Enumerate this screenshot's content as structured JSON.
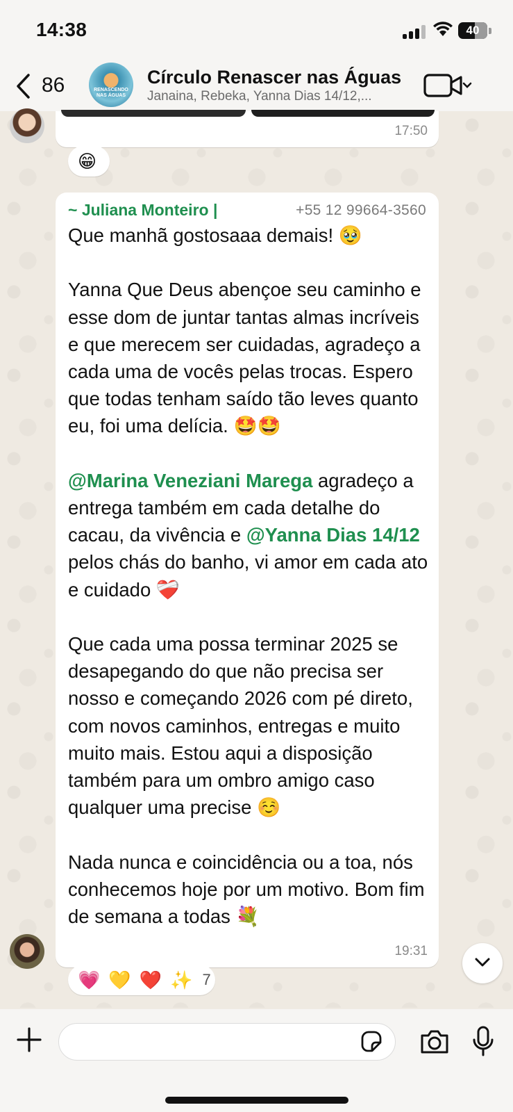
{
  "status_bar": {
    "time": "14:38",
    "battery": "40"
  },
  "header": {
    "back_count": "86",
    "title": "Círculo Renascer nas Águas",
    "subtitle": "Janaina, Rebeka, Yanna Dias 14/12,...",
    "avatar_text": "RENASCENDO NAS ÁGUAS"
  },
  "previous_message": {
    "time": "17:50",
    "reaction": "😁"
  },
  "message": {
    "sender_name": "~ Juliana Monteiro |",
    "sender_phone": "+55 12 99664-3560",
    "p1": "Que manhã gostosaaa demais! 🥹",
    "p2": "Yanna Que Deus abençoe seu caminho e esse dom de juntar tantas almas incríveis e que merecem ser cuidadas, agradeço a cada uma de vocês pelas trocas. Espero que todas tenham saído tão leves quanto eu, foi uma delícia. 🤩🤩",
    "mention1": "@Marina Veneziani Marega",
    "p3a": " agradeço a entrega também em cada detalhe do cacau, da vivência e ",
    "mention2": "@Yanna Dias 14/12",
    "p3b": " pelos chás do banho, vi amor em cada ato e cuidado ❤️‍🩹",
    "p4": "Que cada uma possa terminar 2025 se desapegando do que não precisa ser nosso e começando 2026 com pé direto, com novos caminhos, entregas e muito muito mais. Estou aqui a disposição também para um ombro amigo caso qualquer uma precise ☺️",
    "p5": "Nada nunca e coincidência ou a toa, nós conhecemos hoje por um motivo. Bom fim de semana a todas 💐",
    "time": "19:31",
    "reactions": [
      "💗",
      "💛",
      "❤️",
      "✨"
    ],
    "reaction_count": "7"
  },
  "composer": {
    "placeholder": ""
  }
}
